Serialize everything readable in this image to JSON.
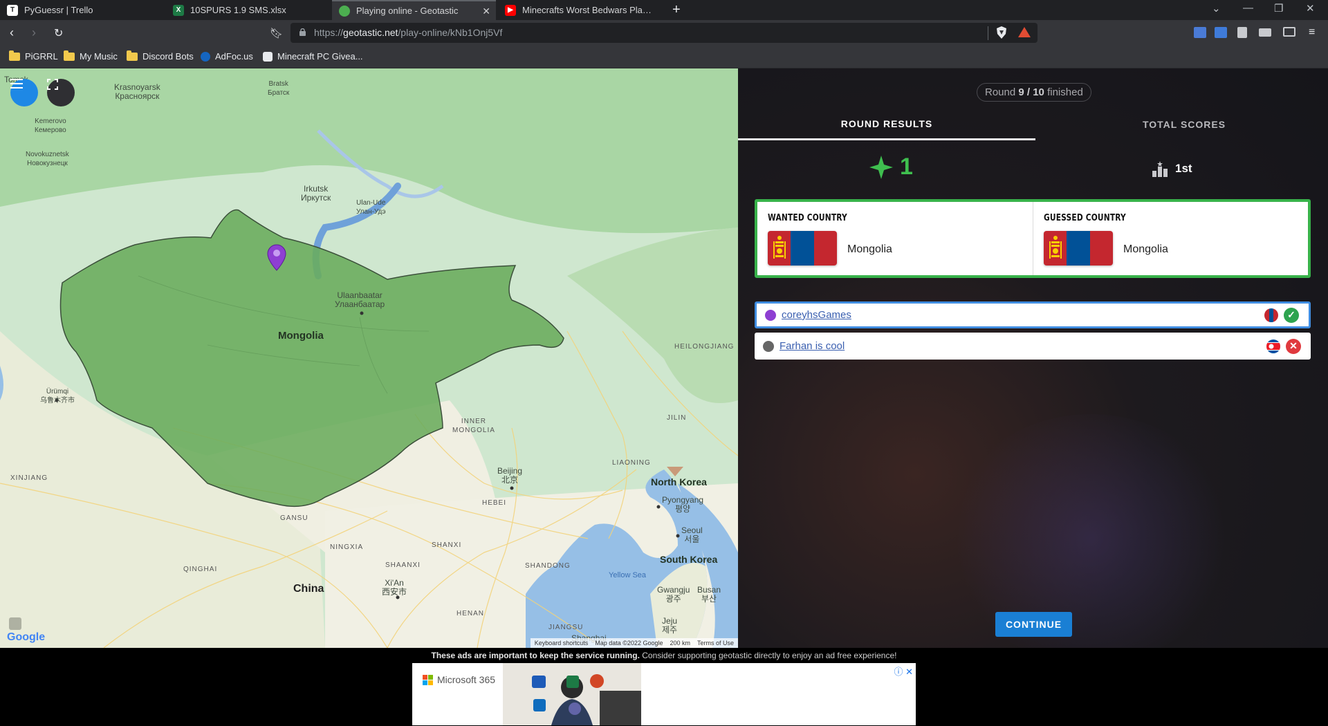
{
  "browser": {
    "tabs": [
      {
        "title": "PyGuessr | Trello",
        "active": false
      },
      {
        "title": "10SPURS 1.9 SMS.xlsx",
        "active": false
      },
      {
        "title": "Playing online - Geotastic",
        "active": true
      },
      {
        "title": "Minecrafts Worst Bedwars Player - You",
        "active": false
      }
    ],
    "url_prefix": "https://",
    "url_host": "geotastic.net",
    "url_path": "/play-online/kNb1Onj5Vf",
    "bookmarks": [
      "PiGRRL",
      "My Music",
      "Discord Bots",
      "AdFoc.us",
      "Minecraft PC Givea..."
    ]
  },
  "map": {
    "labels": {
      "tomsk": "Tomsk",
      "krasnoyarsk": "Krasnoyarsk",
      "krasnoyarsk_ru": "Красноярск",
      "bratsk": "Bratsk",
      "bratsk_ru": "Братск",
      "kemerovo": "Kemerovo",
      "kemerovo_ru": "Кемерово",
      "novokuznetsk": "Novokuznetsk",
      "novokuznetsk_ru": "Новокузнецк",
      "irkutsk": "Irkutsk",
      "irkutsk_ru": "Иркутск",
      "ulanude": "Ulan-Ude",
      "ulanude_ru": "Улан-Удэ",
      "ulaanbaatar": "Ulaanbaatar",
      "ulaanbaatar_mn": "Улаанбаатар",
      "mongolia": "Mongolia",
      "heilongjiang": "HEILONGJIANG",
      "urumqi": "Ürümqi",
      "urumqi_cn": "乌鲁木齐市",
      "inner_mongolia_1": "INNER",
      "inner_mongolia_2": "MONGOLIA",
      "jilin": "JILIN",
      "xinjiang": "XINJIANG",
      "liaoning": "LIAONING",
      "beijing": "Beijing",
      "beijing_cn": "北京",
      "north_korea": "North Korea",
      "pyongyang": "Pyongyang",
      "pyongyang_kr": "평양",
      "hebei": "HEBEI",
      "gansu": "GANSU",
      "seoul": "Seoul",
      "seoul_kr": "서울",
      "ningxia": "NINGXIA",
      "shanxi": "SHANXI",
      "shaanxi": "SHAANXI",
      "shandong": "SHANDONG",
      "south_korea": "South Korea",
      "qinghai": "QINGHAI",
      "yellow_sea": "Yellow Sea",
      "xian": "Xi'An",
      "xian_cn": "西安市",
      "china": "China",
      "henan": "HENAN",
      "jiangsu": "JIANGSU",
      "shanghai": "Shanghai",
      "gwangju": "Gwangju",
      "gwangju_kr": "광주",
      "busan": "Busan",
      "busan_kr": "부산",
      "jeju": "Jeju",
      "jeju_kr": "제주"
    },
    "footer": {
      "shortcuts": "Keyboard shortcuts",
      "mapdata": "Map data ©2022 Google",
      "scale": "200 km",
      "terms": "Terms of Use"
    },
    "logo": "Google"
  },
  "results": {
    "round_prefix": "Round",
    "round_current": "9 / 10",
    "round_suffix": "finished",
    "tab_round": "ROUND RESULTS",
    "tab_total": "TOTAL SCORES",
    "score": "1",
    "rank": "1st",
    "wanted_label": "WANTED COUNTRY",
    "wanted_country": "Mongolia",
    "guessed_label": "GUESSED COUNTRY",
    "guessed_country": "Mongolia",
    "players": [
      {
        "name": "coreyhsGames",
        "correct": true
      },
      {
        "name": "Farhan is cool",
        "correct": false
      }
    ],
    "continue_label": "CONTINUE"
  },
  "ad": {
    "notice_bold": "These ads are important to keep the service running.",
    "notice_rest": " Consider supporting geotastic directly to enjoy an ad free experience!",
    "brand": "Microsoft 365"
  },
  "colors": {
    "accent_green": "#3fbf4f",
    "continue_blue": "#1a7fd4",
    "mongolia_fill": "#6aac5c"
  }
}
